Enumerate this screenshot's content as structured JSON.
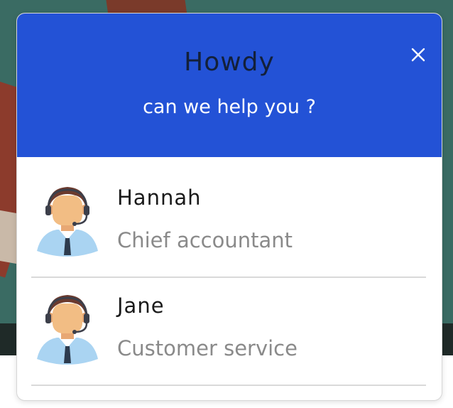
{
  "header": {
    "title": "Howdy",
    "subtitle": "can we help you ?",
    "close_icon": "close-icon"
  },
  "agents": [
    {
      "name": "Hannah",
      "role": "Chief accountant",
      "avatar_icon": "support-agent-avatar"
    },
    {
      "name": "Jane",
      "role": "Customer service",
      "avatar_icon": "support-agent-avatar"
    }
  ],
  "colors": {
    "header_bg": "#2352d6",
    "title_text": "#13203a",
    "subtitle_text": "#ffffff",
    "role_text": "#8a8a8a",
    "divider": "#d9d9d9"
  }
}
